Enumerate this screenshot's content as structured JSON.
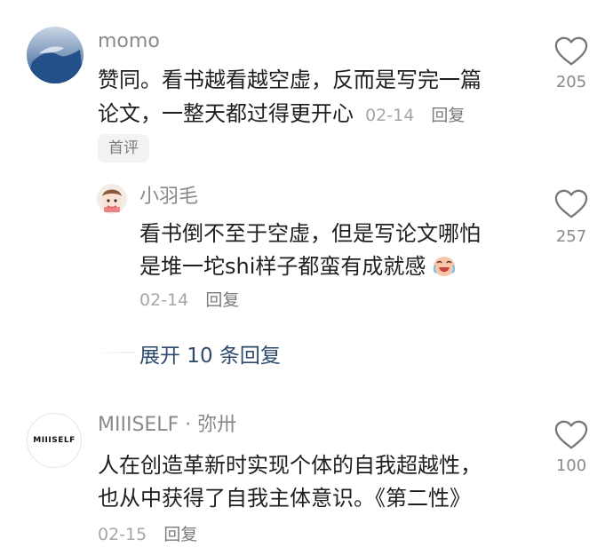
{
  "comments": [
    {
      "author": "momo",
      "text_line1": "赞同。看书越看越空虚，反而是写完一篇",
      "text_line2": "论文，一整天都过得更开心",
      "date": "02-14",
      "reply": "回复",
      "badge": "首评",
      "likes": "205"
    },
    {
      "author": "小羽毛",
      "text_line1": "看书倒不至于空虚，但是写论文哪怕",
      "text_line2": "是堆一坨shi样子都蛮有成就感",
      "date": "02-14",
      "reply": "回复",
      "likes": "257"
    },
    {
      "author": "MIIISELF · 弥卅",
      "avatar_text": "MIIISELF",
      "text_line1": "人在创造革新时实现个体的自我超越性，",
      "text_line2": "也从中获得了自我主体意识。《第二性》",
      "date": "02-15",
      "reply": "回复",
      "likes": "100"
    }
  ],
  "expand_replies": "展开 10 条回复",
  "colors": {
    "link": "#2d4a6c",
    "muted": "#8a8a8a",
    "text": "#1f1f1f"
  }
}
